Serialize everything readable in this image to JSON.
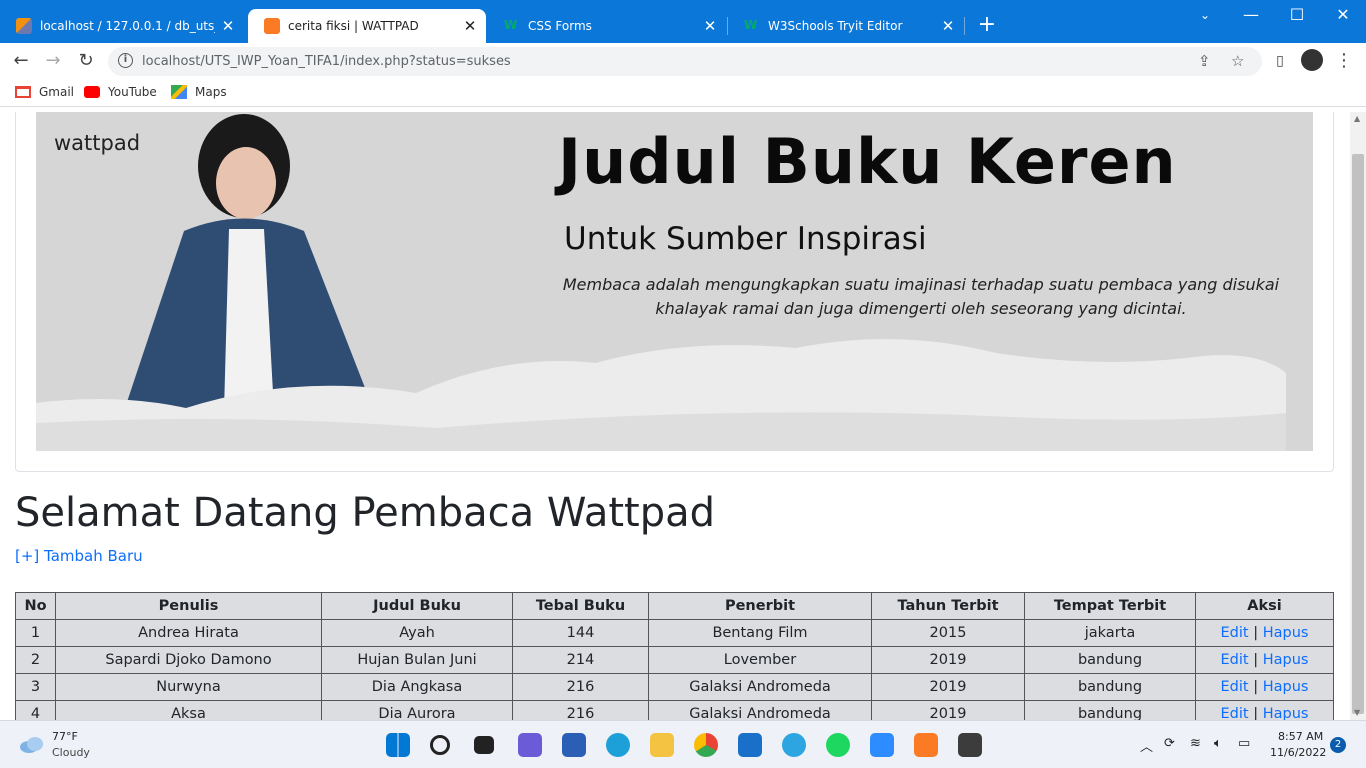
{
  "browser": {
    "tabs": [
      {
        "title": "localhost / 127.0.0.1 / db_uts_iwp",
        "active": false
      },
      {
        "title": "cerita fiksi | WATTPAD",
        "active": true
      },
      {
        "title": "CSS Forms",
        "active": false
      },
      {
        "title": "W3Schools Tryit Editor",
        "active": false
      }
    ],
    "url": "localhost/UTS_IWP_Yoan_TIFA1/index.php?status=sukses",
    "bookmarks": [
      "Gmail",
      "YouTube",
      "Maps"
    ]
  },
  "banner": {
    "brand": "wattpad",
    "title": "Judul Buku Keren",
    "subtitle": "Untuk Sumber Inspirasi",
    "quote": "Membaca adalah mengungkapkan suatu imajinasi terhadap suatu pembaca yang disukai khalayak ramai dan juga dimengerti oleh seseorang yang dicintai."
  },
  "page": {
    "heading": "Selamat Datang Pembaca Wattpad",
    "add_link": "[+] Tambah Baru"
  },
  "table": {
    "headers": [
      "No",
      "Penulis",
      "Judul Buku",
      "Tebal Buku",
      "Penerbit",
      "Tahun Terbit",
      "Tempat Terbit",
      "Aksi"
    ],
    "rows": [
      {
        "no": "1",
        "penulis": "Andrea Hirata",
        "judul": "Ayah",
        "tebal": "144",
        "penerbit": "Bentang Film",
        "tahun": "2015",
        "tempat": "jakarta"
      },
      {
        "no": "2",
        "penulis": "Sapardi Djoko Damono",
        "judul": "Hujan Bulan Juni",
        "tebal": "214",
        "penerbit": "Lovember",
        "tahun": "2019",
        "tempat": "bandung"
      },
      {
        "no": "3",
        "penulis": "Nurwyna",
        "judul": "Dia Angkasa",
        "tebal": "216",
        "penerbit": "Galaksi Andromeda",
        "tahun": "2019",
        "tempat": "bandung"
      },
      {
        "no": "4",
        "penulis": "Aksa",
        "judul": "Dia Aurora",
        "tebal": "216",
        "penerbit": "Galaksi Andromeda",
        "tahun": "2019",
        "tempat": "bandung"
      }
    ],
    "edit_label": "Edit",
    "separator": "|",
    "delete_label": "Hapus"
  },
  "taskbar": {
    "temperature": "77°F",
    "weather": "Cloudy",
    "time": "8:57 AM",
    "date": "11/6/2022",
    "notifications": "2"
  },
  "colors": {
    "chrome_accent": "#0b77d8",
    "link": "#0d6efd",
    "table_bg": "#dcdde0"
  }
}
